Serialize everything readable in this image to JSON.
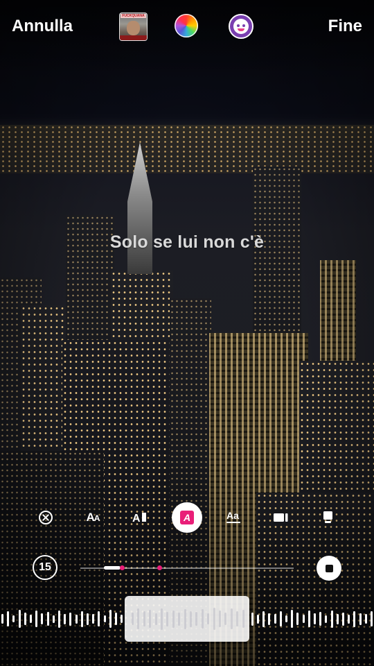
{
  "topbar": {
    "cancel_label": "Annulla",
    "done_label": "Fine",
    "thumbnail_caption": "FUCKQUANA",
    "color_picker_icon": "color-wheel-icon",
    "effects_icon": "face-effects-icon"
  },
  "lyric": {
    "text": "Solo se lui non c'è"
  },
  "toolbar": {
    "items": [
      {
        "name": "remove-style",
        "icon": "close-circle-icon"
      },
      {
        "name": "font-size",
        "label": "AA",
        "icon": "text-size-icon"
      },
      {
        "name": "text-align",
        "label": "A",
        "icon": "text-cursor-icon"
      },
      {
        "name": "text-color",
        "label": "A",
        "icon": "highlight-a-icon",
        "selected": true
      },
      {
        "name": "text-style",
        "label": "Aa",
        "icon": "text-style-icon"
      },
      {
        "name": "layout-video",
        "icon": "video-layout-icon"
      },
      {
        "name": "layout-card",
        "icon": "card-layout-icon"
      },
      {
        "name": "more",
        "icon": "more-icon"
      }
    ],
    "accent_color": "#e91e78"
  },
  "timeline": {
    "duration_label": "15",
    "stop_icon": "stop-icon"
  }
}
